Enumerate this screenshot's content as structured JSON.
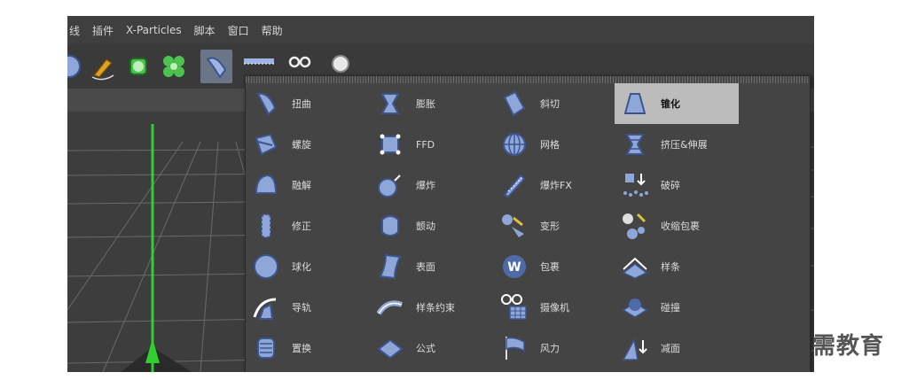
{
  "menubar": {
    "items": [
      "线",
      "插件",
      "X-Particles",
      "脚本",
      "窗口",
      "帮助"
    ]
  },
  "toolbar": {
    "active_index": 5,
    "buttons": [
      "sphere-icon",
      "pen-icon",
      "cube-generator-icon",
      "cloner-icon",
      "bend-deformer-icon",
      "floor-icon",
      "camera-icon",
      "light-icon"
    ]
  },
  "viewport": {
    "nav_icons": "✣ ⇣ ◐"
  },
  "deformer_menu": {
    "columns": [
      [
        {
          "label": "扭曲",
          "icon": "bend-icon"
        },
        {
          "label": "螺旋",
          "icon": "twist-icon"
        },
        {
          "label": "融解",
          "icon": "melt-icon"
        },
        {
          "label": "修正",
          "icon": "correction-icon"
        },
        {
          "label": "球化",
          "icon": "spherify-icon"
        },
        {
          "label": "导轨",
          "icon": "rail-icon"
        },
        {
          "label": "置换",
          "icon": "displacer-icon"
        }
      ],
      [
        {
          "label": "膨胀",
          "icon": "bulge-icon"
        },
        {
          "label": "FFD",
          "icon": "ffd-icon"
        },
        {
          "label": "爆炸",
          "icon": "explosion-icon"
        },
        {
          "label": "颤动",
          "icon": "jiggle-icon"
        },
        {
          "label": "表面",
          "icon": "surface-icon"
        },
        {
          "label": "样条约束",
          "icon": "spline-wrap-icon"
        },
        {
          "label": "公式",
          "icon": "formula-icon"
        }
      ],
      [
        {
          "label": "斜切",
          "icon": "shear-icon"
        },
        {
          "label": "网格",
          "icon": "mesh-icon"
        },
        {
          "label": "爆炸FX",
          "icon": "explosion-fx-icon"
        },
        {
          "label": "变形",
          "icon": "morph-icon"
        },
        {
          "label": "包裹",
          "icon": "wrap-icon"
        },
        {
          "label": "摄像机",
          "icon": "camera-deformer-icon"
        },
        {
          "label": "风力",
          "icon": "wind-icon"
        }
      ],
      [
        {
          "label": "锥化",
          "icon": "taper-icon"
        },
        {
          "label": "挤压&伸展",
          "icon": "squash-stretch-icon"
        },
        {
          "label": "破碎",
          "icon": "shatter-icon"
        },
        {
          "label": "收缩包裹",
          "icon": "shrink-wrap-icon"
        },
        {
          "label": "样条",
          "icon": "spline-icon"
        },
        {
          "label": "碰撞",
          "icon": "collision-icon"
        },
        {
          "label": "减面",
          "icon": "polygon-reduction-icon"
        }
      ]
    ],
    "highlighted": "锥化"
  },
  "watermark": {
    "text": "需教育"
  },
  "colors": {
    "app_bg": "#3b3b3b",
    "menu_bg": "#444444",
    "icon_blue": "#8fa6d8",
    "icon_blue_dark": "#4f6aa8",
    "highlight": "#bcbcbc",
    "axis_green": "#2ecf2e"
  }
}
